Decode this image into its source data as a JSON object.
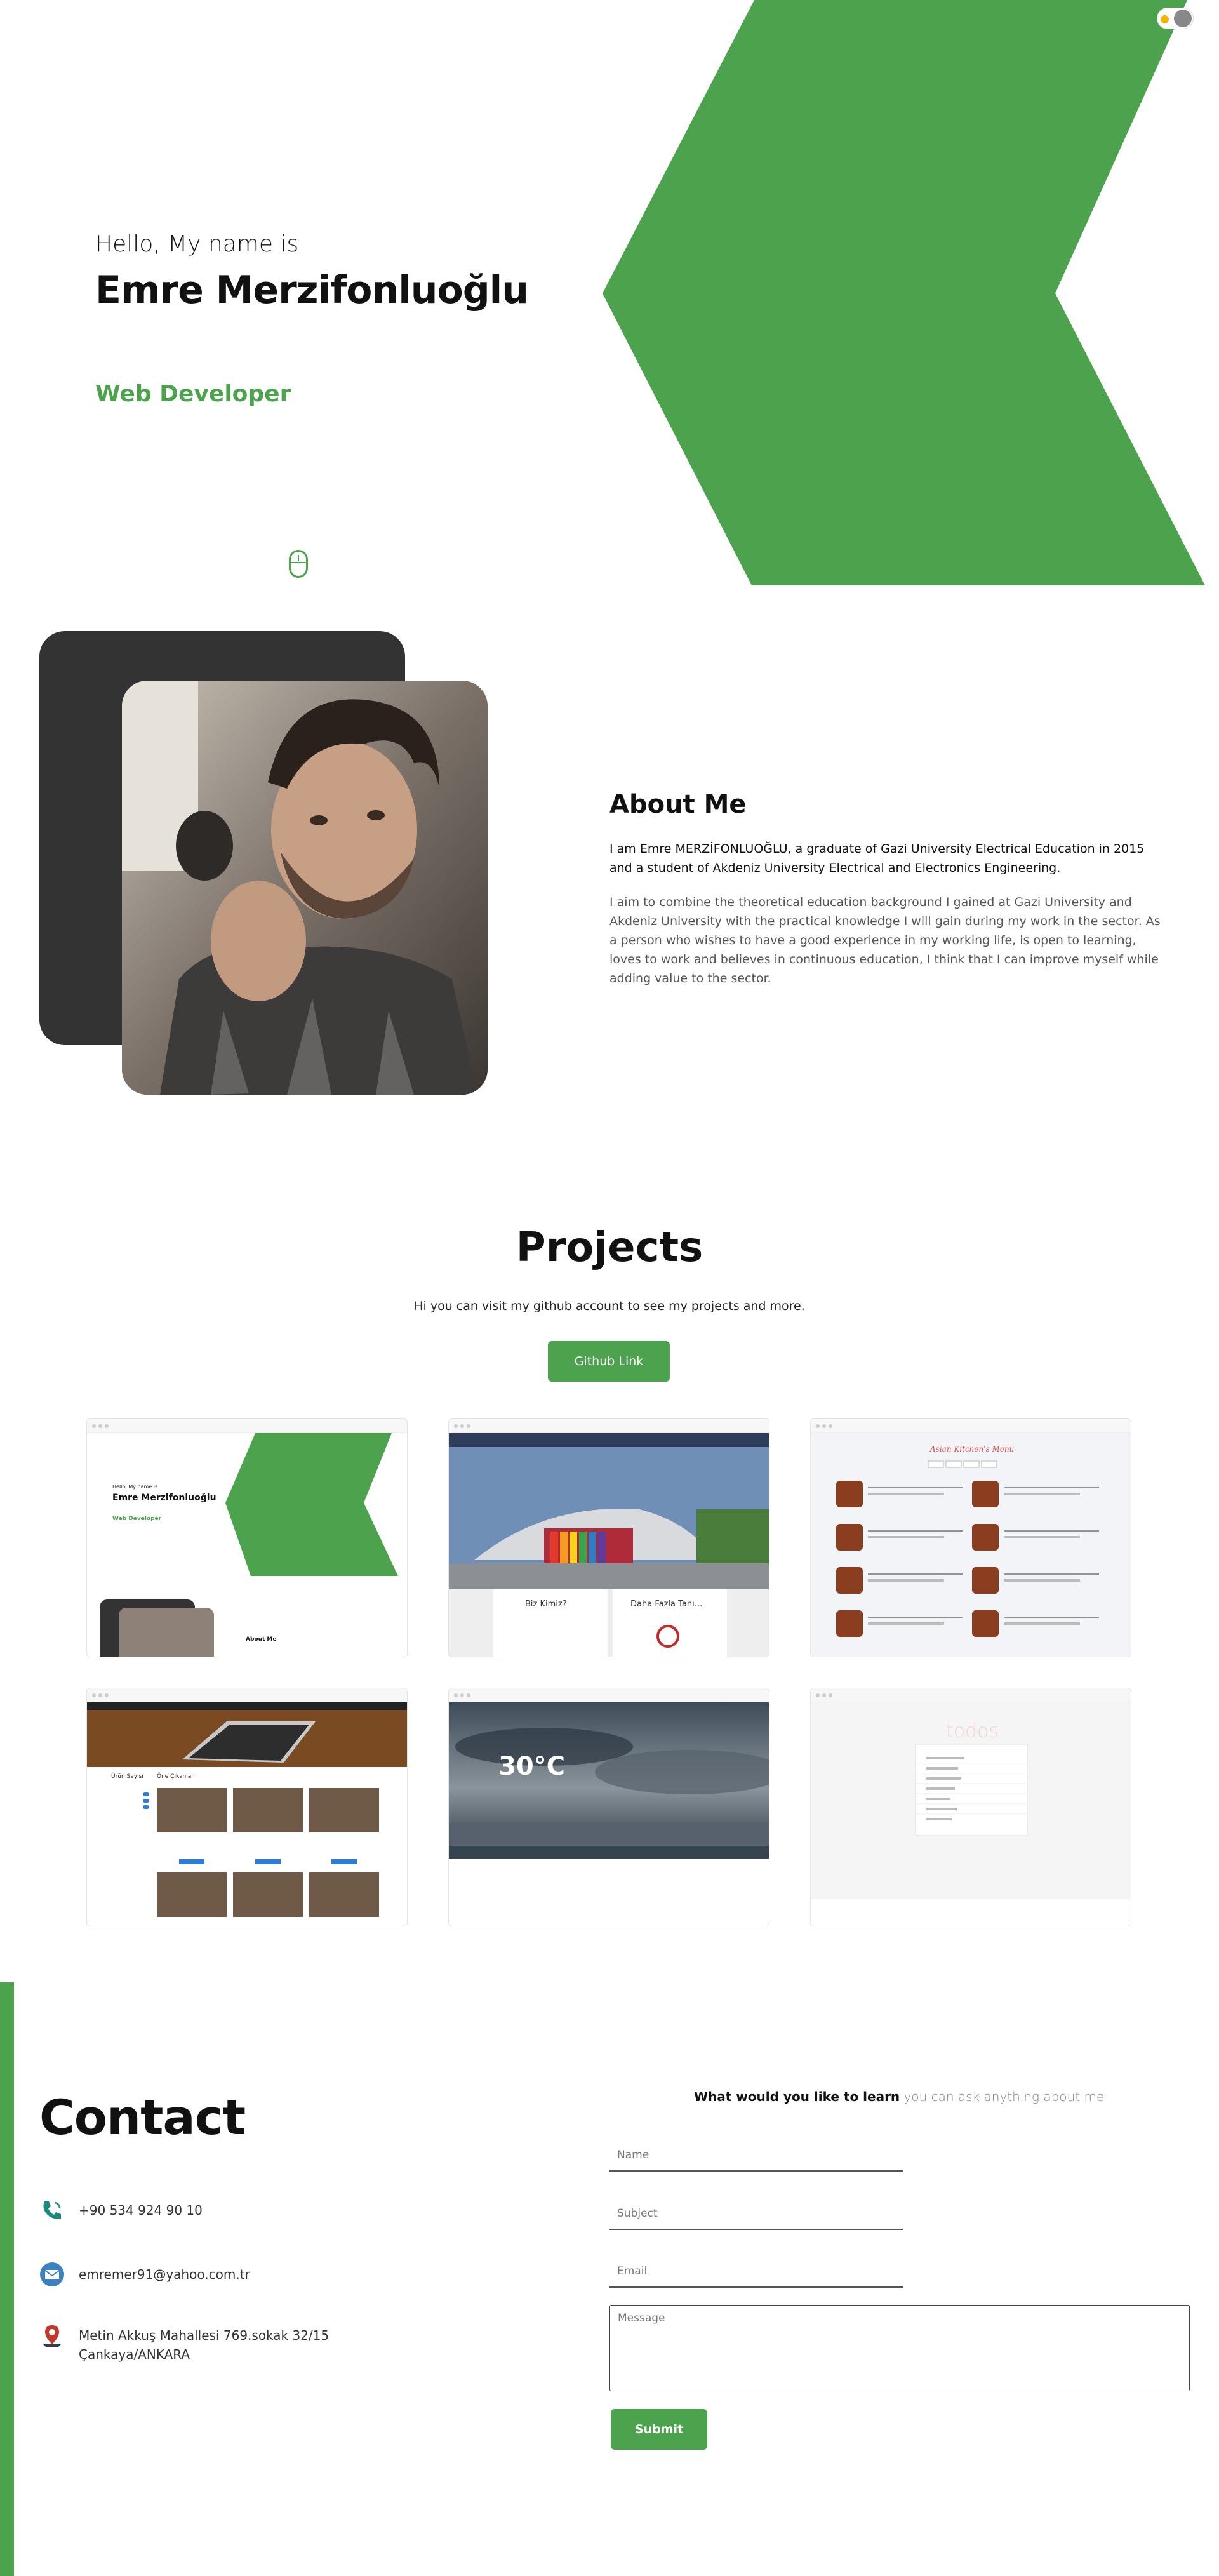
{
  "colors": {
    "accent": "#4da34d",
    "dark": "#333333",
    "text": "#111111"
  },
  "hero": {
    "greeting": "Hello, My name is",
    "name": "Emre Merzifonluoğlu",
    "role": "Web Developer",
    "theme_toggle_icon": "sun-icon",
    "scroll_icon": "mouse-icon"
  },
  "about": {
    "title": "About Me",
    "paragraph1": "I am Emre MERZİFONLUOĞLU, a graduate of Gazi University Electrical Education in 2015 and a student of Akdeniz University Electrical and Electronics Engineering.",
    "paragraph2": "I aim to combine the theoretical education background I gained at Gazi University and Akdeniz University with the practical knowledge I will gain during my work in the sector. As a person who wishes to have a good experience in my working life, is open to learning, loves to work and believes in continuous education, I think that I can improve myself while adding value to the sector."
  },
  "projects": {
    "title": "Projects",
    "subtitle": "Hi you can visit my github account to see my projects and more.",
    "button": "Github Link",
    "cards": [
      {
        "kind": "portfolio",
        "t1": "Hello, My name is",
        "t2": "Emre Merzifonluoğlu",
        "t3": "Web Developer",
        "t4": "About Me"
      },
      {
        "kind": "school",
        "t1": "Biz Kimiz?",
        "t2": "Daha Fazla Tanı..."
      },
      {
        "kind": "menu",
        "t1": "Asian Kitchen's Menu"
      },
      {
        "kind": "shop",
        "t1": "Ürün Sayısı",
        "t2": "Öne Çıkanlar"
      },
      {
        "kind": "weather",
        "t1": "30°C"
      },
      {
        "kind": "todos",
        "t1": "todos"
      }
    ]
  },
  "contact": {
    "title": "Contact",
    "phone": "+90 534 924 90 10",
    "email": "emremer91@yahoo.com.tr",
    "address_line1": "Metin Akkuş Mahallesi 769.sokak 32/15",
    "address_line2": "Çankaya/ANKARA",
    "form": {
      "heading_bold": "What would you like to learn",
      "heading_light": "you can ask anything about me",
      "name_placeholder": "Name",
      "subject_placeholder": "Subject",
      "email_placeholder": "Email",
      "message_placeholder": "Message",
      "submit": "Submit"
    }
  }
}
